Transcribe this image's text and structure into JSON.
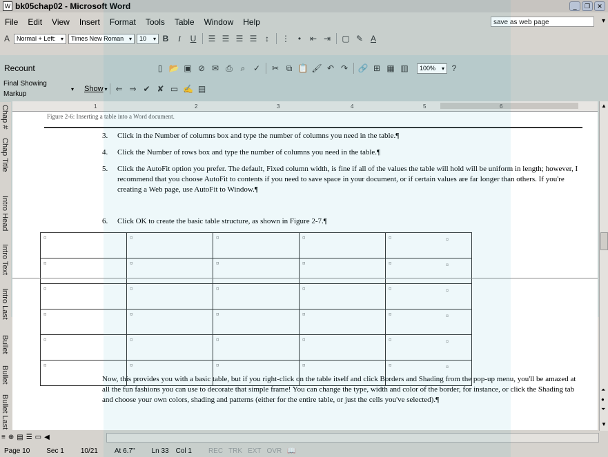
{
  "window": {
    "title": "bk05chap02 - Microsoft Word"
  },
  "menu": {
    "items": [
      "File",
      "Edit",
      "View",
      "Insert",
      "Format",
      "Tools",
      "Table",
      "Window",
      "Help"
    ],
    "ask_box": "save as web page"
  },
  "format_toolbar": {
    "style": "Normal + Left:",
    "font": "Times New Roman",
    "size": "10",
    "zoom": "100%"
  },
  "standard_toolbar": {
    "label": "Recount"
  },
  "reviewing_toolbar": {
    "markup": "Final Showing Markup",
    "show": "Show"
  },
  "style_area": {
    "labels": [
      "Chap #",
      "Chap Title",
      "Intro Head",
      "Intro Text",
      "Intro Last",
      "Bullet",
      "Bullet",
      "Bullet Last"
    ]
  },
  "ruler": {
    "ticks": [
      "1",
      "2",
      "3",
      "4",
      "5",
      "6"
    ]
  },
  "document": {
    "caption": "Figure 2-6: Inserting a table into a Word document.",
    "steps": [
      {
        "num": "3.",
        "text": "Click in the Number of columns box and type the number of columns you need in the table.¶"
      },
      {
        "num": "4.",
        "text": "Click the Number of rows box and type the number of columns you need in the table.¶"
      },
      {
        "num": "5.",
        "text": "Click the AutoFit option you prefer.  The default, Fixed column width, is fine if all of the values the table will hold will be uniform in length; however, I recommend that you choose AutoFit to contents if you need to save space in your document, or if certain values are far longer than others. If you're creating a Web page, use AutoFit to Window.¶"
      },
      {
        "num": "6.",
        "text": "Click OK to create the basic table structure, as shown in Figure 2-7.¶"
      }
    ],
    "cell_mark": "¤",
    "paragraph": "Now, this provides you with a basic table, but if you right-click on the table itself and click Borders and Shading from the pop-up menu, you'll be amazed at all the fun fashions you can use to decorate that simple frame! You can change the type, width and color of the border, for instance, or click the Shading tab and choose your own colors, shading and patterns (either for the entire table, or just the cells you've selected).¶"
  },
  "status": {
    "page": "Page 10",
    "sec": "Sec 1",
    "pages": "10/21",
    "at": "At 6.7\"",
    "ln": "Ln 33",
    "col": "Col 1",
    "rec": "REC",
    "trk": "TRK",
    "ext": "EXT",
    "ovr": "OVR"
  },
  "colors": {
    "watermark": "#28aabe",
    "chrome": "#d6d3ce"
  }
}
